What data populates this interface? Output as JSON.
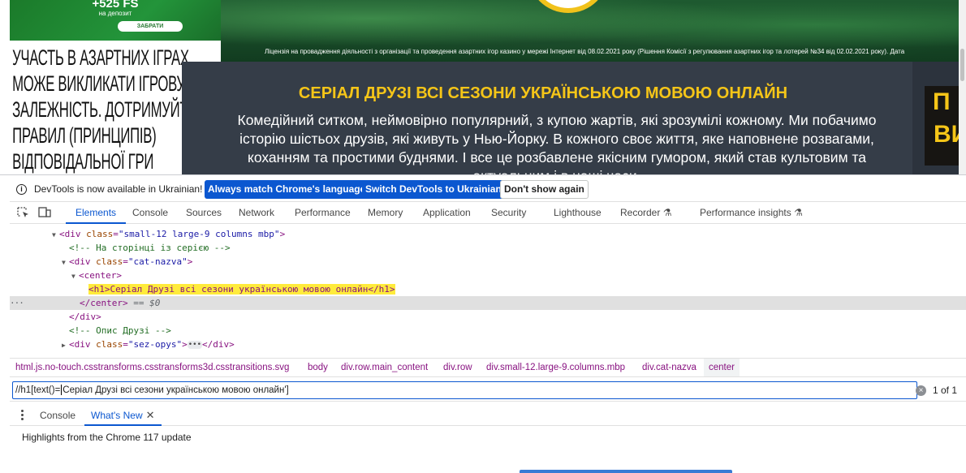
{
  "page": {
    "promo": {
      "fs": "+525 FS",
      "deposit": "на депозит",
      "button": "ЗАБРАТИ"
    },
    "license": "Ліцензія на провадження діяльності з організації та проведення азартних ігор казино у мережі Інтернет від 08.02.2021 року (Рішення Комісії з регулювання азартних ігор та лотерей №34 від 02.02.2021 року). Дата",
    "warning": "УЧАСТЬ В АЗАРТНИХ ІГРАХ\nМОЖЕ ВИКЛИКАТИ ІГРОВУ\nЗАЛЕЖНІСТЬ. ДОТРИМУЙТЕСЯ\nПРАВИЛ (ПРИНЦИПІВ)\nВІДПОВІДАЛЬНОЇ ГРИ",
    "h1": "СЕРІАЛ ДРУЗІ ВСІ СЕЗОНИ УКРАЇНСЬКОЮ МОВОЮ ОНЛАЙН",
    "description": "Комедійний ситком, неймовірно популярний, з купою жартів, які зрозумілі кожному. Ми побачимо історію шістьох друзів, які живуть у Нью-Йорку. В кожного своє життя, яке наповнене розвагами, коханням та простими буднями. І все це розбавлене якісним гумором, який став культовим та актуальним і в наші часи.",
    "right_ad": {
      "line1": "П",
      "line2": "ВИ"
    }
  },
  "devtools": {
    "infobar": {
      "message": "DevTools is now available in Ukrainian!",
      "btn_match": "Always match Chrome's language",
      "btn_switch": "Switch DevTools to Ukrainian",
      "btn_dismiss": "Don't show again"
    },
    "tabs": [
      "Elements",
      "Console",
      "Sources",
      "Network",
      "Performance",
      "Memory",
      "Application",
      "Security",
      "Lighthouse",
      "Recorder",
      "Performance insights"
    ],
    "dom": {
      "div1_open": "<div",
      "div1_attr": "class",
      "div1_val": "\"small-12 large-9 columns mbp\"",
      "div1_close": ">",
      "comment1": "<!-- На сторінці із серією -->",
      "div2_open": "<div",
      "div2_attr": "class",
      "div2_val": "\"cat-nazva\"",
      "div2_close": ">",
      "center_open": "<center>",
      "h1_line": "<h1>Серіал Друзі всі сезони українською мовою онлайн</h1>",
      "center_close": "</center>",
      "dollar0": "== $0",
      "div_close": "</div>",
      "comment2": "<!-- Опис Друзі -->",
      "div3_open": "<div",
      "div3_attr": "class",
      "div3_val": "\"sez-opys\"",
      "div3_mid": ">",
      "div3_ellipsis": "•••",
      "div3_close": "</div>"
    },
    "breadcrumbs": [
      "html.js.no-touch.csstransforms.csstransforms3d.csstransitions.svg",
      "body",
      "div.row.main_content",
      "div.row",
      "div.small-12.large-9.columns.mbp",
      "div.cat-nazva",
      "center"
    ],
    "search": {
      "before_caret": "//h1[text()=",
      "after_caret": "Серіал Друзі всі сезони українською мовою онлайн']",
      "count": "1 of 1"
    },
    "drawer": {
      "tabs": [
        "Console",
        "What's New"
      ],
      "highlights": "Highlights from the Chrome 117 update"
    }
  },
  "colors": {
    "accent": "#0b57d0",
    "page_title": "#f5c518",
    "content_bg": "#353d48"
  }
}
